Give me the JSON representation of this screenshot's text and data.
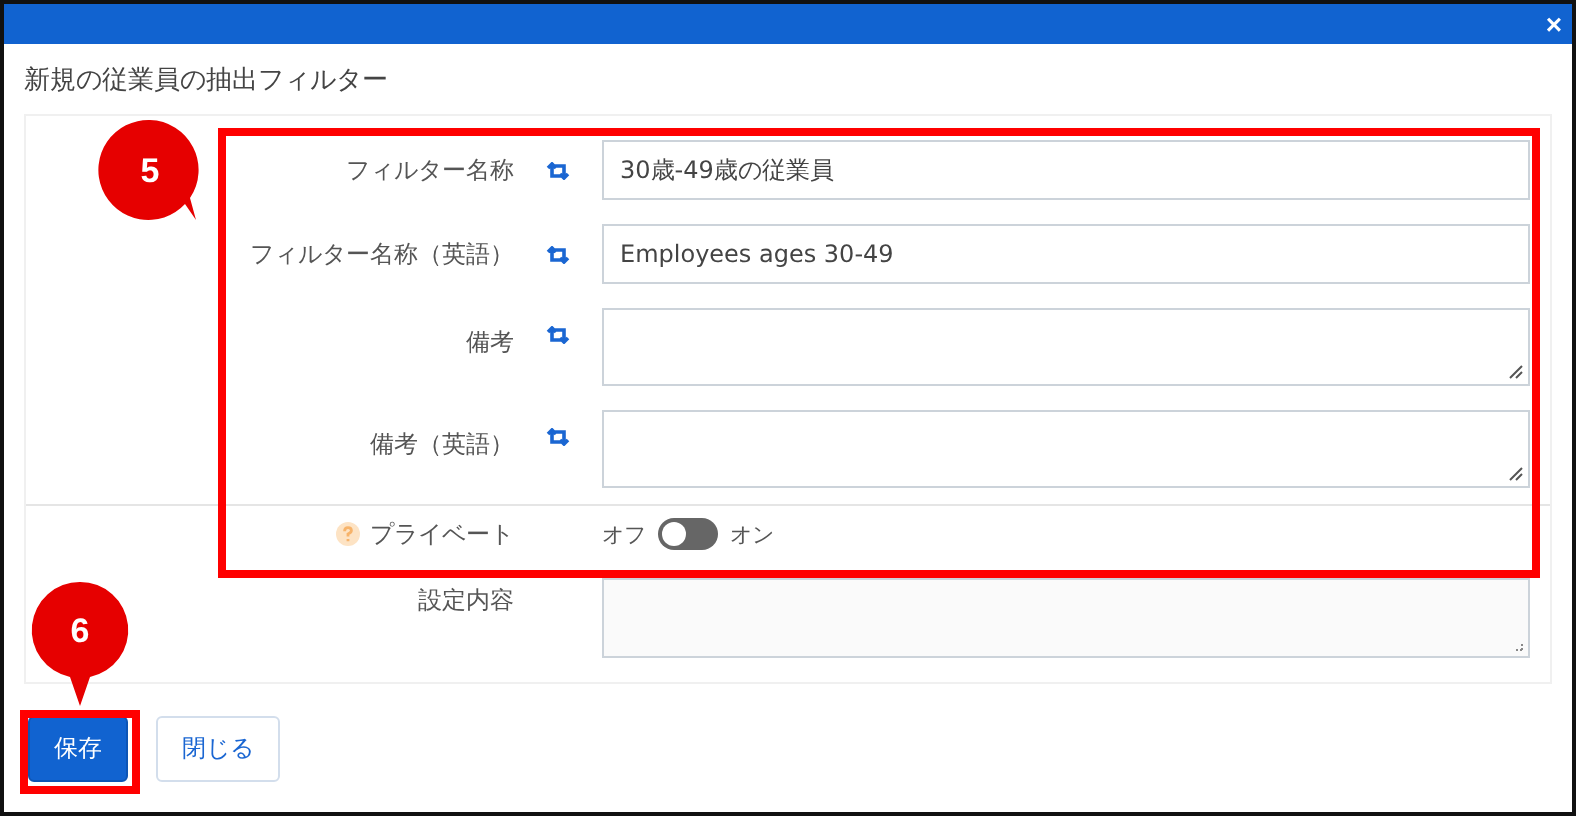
{
  "window": {
    "close_glyph": "×"
  },
  "dialog": {
    "title": "新規の従業員の抽出フィルター"
  },
  "fields": [
    {
      "kind": "input",
      "label": "フィルター名称",
      "value": "30歳-49歳の従業員"
    },
    {
      "kind": "input",
      "label": "フィルター名称（英語）",
      "value": "Employees ages 30-49"
    },
    {
      "kind": "textarea",
      "label": "備考"
    },
    {
      "kind": "textarea",
      "label": "備考（英語）"
    }
  ],
  "private": {
    "label": "プライベート",
    "off_label": "オフ",
    "on_label": "オン",
    "on": false
  },
  "settings": {
    "label": "設定内容"
  },
  "buttons": [
    {
      "label": "保存",
      "kind": "primary"
    },
    {
      "label": "閉じる",
      "kind": "secondary"
    }
  ],
  "callouts": [
    {
      "label": "5"
    },
    {
      "label": "6"
    }
  ]
}
